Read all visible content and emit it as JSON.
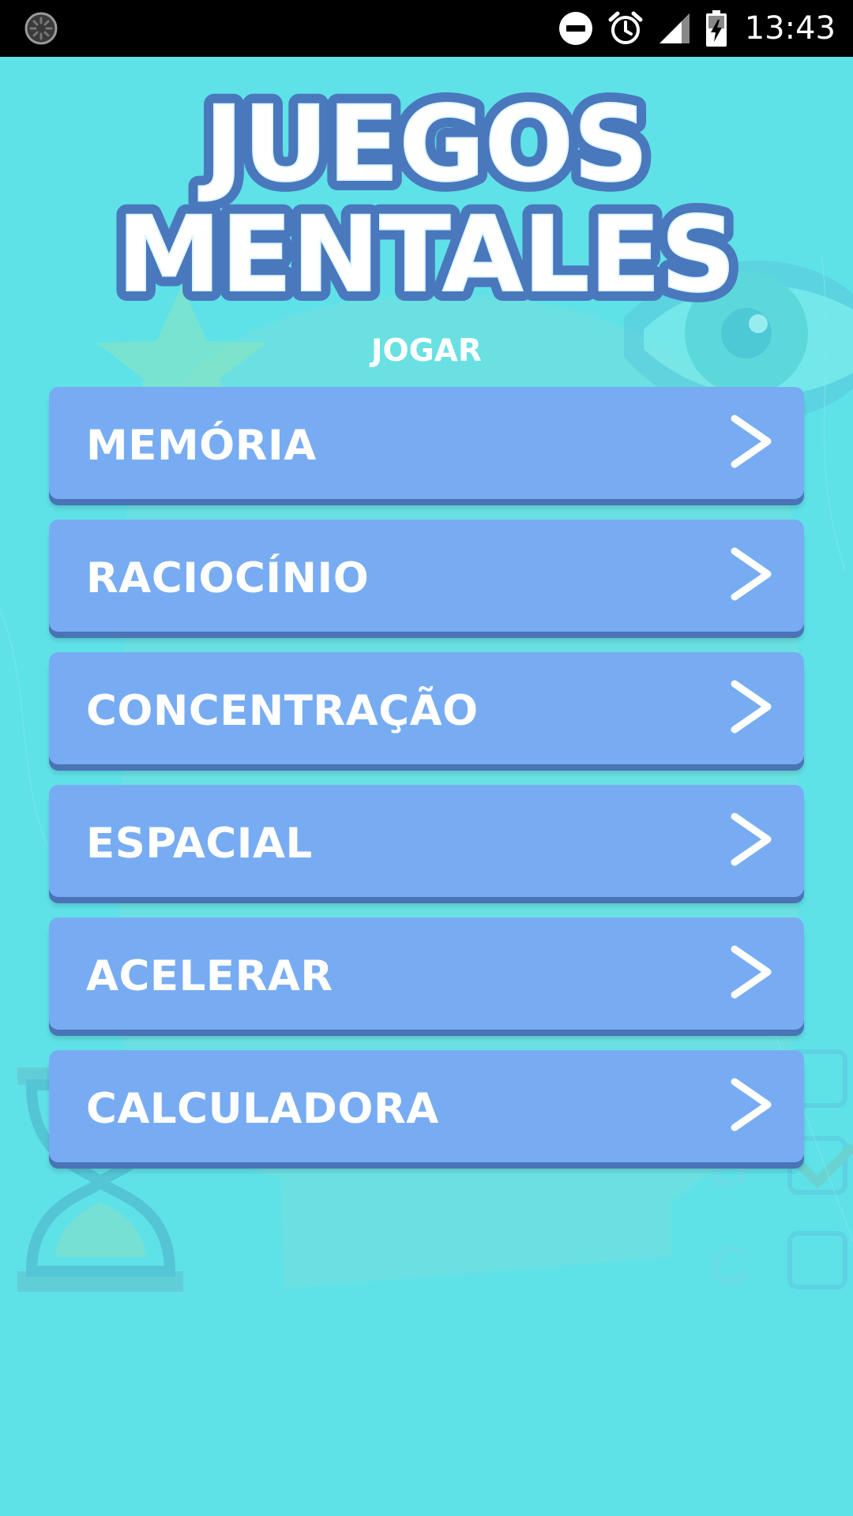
{
  "status_bar": {
    "time": "13:43",
    "icons": [
      "loading-icon",
      "do-not-disturb-icon",
      "alarm-icon",
      "signal-icon",
      "battery-charging-icon"
    ]
  },
  "app": {
    "logo": {
      "line1": "JUEGOS",
      "line2": "MENTALES"
    },
    "section_label": "JOGAR",
    "menu": [
      {
        "label": "MEMÓRIA",
        "icon": "chevron-right-icon"
      },
      {
        "label": "RACIOCÍNIO",
        "icon": "chevron-right-icon"
      },
      {
        "label": "CONCENTRAÇÃO",
        "icon": "chevron-right-icon"
      },
      {
        "label": "ESPACIAL",
        "icon": "chevron-right-icon"
      },
      {
        "label": "ACELERAR",
        "icon": "chevron-right-icon"
      },
      {
        "label": "CALCULADORA",
        "icon": "chevron-right-icon"
      }
    ]
  },
  "colors": {
    "background": "#5fe1e8",
    "button": "#78acf2",
    "button_shadow": "#4a74b6",
    "logo_outline": "#4a78bd",
    "text": "#ffffff"
  }
}
